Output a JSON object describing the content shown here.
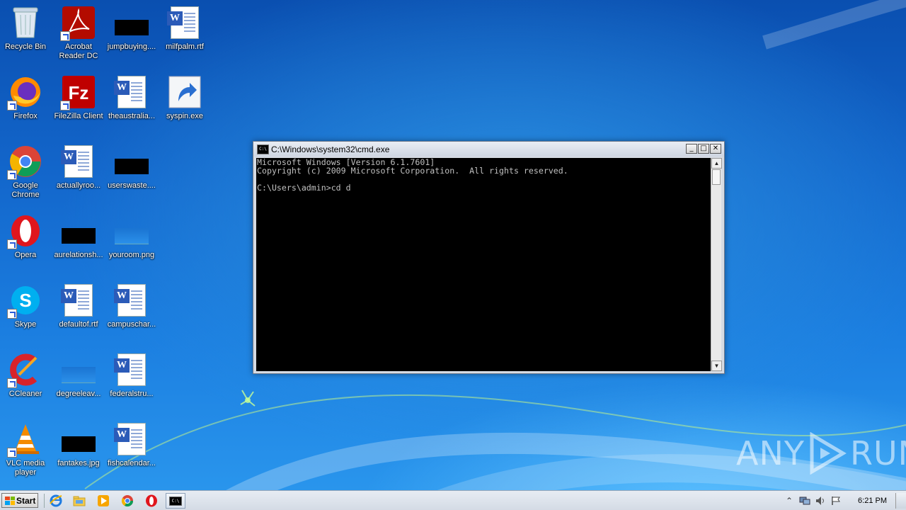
{
  "desktop": {
    "icons": [
      {
        "label": "Recycle Bin"
      },
      {
        "label": "Acrobat Reader DC"
      },
      {
        "label": "jumpbuying...."
      },
      {
        "label": "milfpalm.rtf"
      },
      {
        "label": "Firefox"
      },
      {
        "label": "FileZilla Client"
      },
      {
        "label": "theaustralia..."
      },
      {
        "label": "syspin.exe"
      },
      {
        "label": "Google Chrome"
      },
      {
        "label": "actuallyroo..."
      },
      {
        "label": "userswaste...."
      },
      {
        "label": "Opera"
      },
      {
        "label": "aurelationsh..."
      },
      {
        "label": "youroom.png"
      },
      {
        "label": "Skype"
      },
      {
        "label": "defaultof.rtf"
      },
      {
        "label": "campuschar..."
      },
      {
        "label": "CCleaner"
      },
      {
        "label": "degreeleav..."
      },
      {
        "label": "federalstru..."
      },
      {
        "label": "VLC media player"
      },
      {
        "label": "fantakes.jpg"
      },
      {
        "label": "fishcalendar..."
      }
    ]
  },
  "cmd": {
    "title": "C:\\Windows\\system32\\cmd.exe",
    "icon_text": "C:\\",
    "lines": "Microsoft Windows [Version 6.1.7601]\nCopyright (c) 2009 Microsoft Corporation.  All rights reserved.\n\nC:\\Users\\admin>cd d",
    "buttons": {
      "minimize": "_",
      "maximize": "□",
      "close": "✕"
    }
  },
  "taskbar": {
    "start_label": "Start",
    "clock": "6:21 PM",
    "pinned": [
      "ie-icon",
      "explorer-icon",
      "media-player-icon",
      "chrome-icon",
      "opera-icon",
      "cmd-icon"
    ]
  },
  "watermark": {
    "left": "ANY",
    "right": "RUN"
  },
  "colors": {
    "desktop_top": "#0a4fb0",
    "desktop_bottom": "#2b98ee",
    "cmd_bg": "#000000",
    "cmd_text": "#c0c0c0"
  }
}
